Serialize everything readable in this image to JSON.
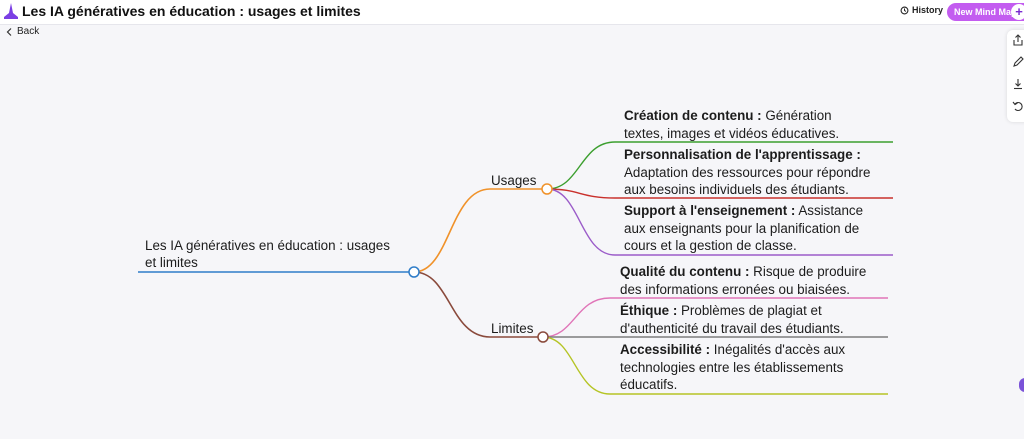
{
  "header": {
    "title": "Les IA génératives en éducation : usages et limites",
    "history_label": "History",
    "new_map_label": "New Mind Map",
    "plus": "+"
  },
  "nav": {
    "back_label": "Back"
  },
  "toolbar": {
    "icons": [
      "share-icon",
      "pen-icon",
      "download-icon",
      "undo-icon"
    ]
  },
  "mindmap": {
    "root": {
      "line1": "Les IA génératives en éducation : usages",
      "line2": "et limites",
      "color": "#2f7dc9"
    },
    "branches": [
      {
        "label": "Usages",
        "color": "#f0922a",
        "children": [
          {
            "bold": "Création de contenu :",
            "rest": " Génération",
            "lines": [
              "textes, images et vidéos éducatives."
            ],
            "color": "#3c9f2f"
          },
          {
            "bold": "Personnalisation de l'apprentissage :",
            "rest": "",
            "lines": [
              "Adaptation des ressources pour répondre",
              "aux besoins individuels des étudiants."
            ],
            "color": "#c9302c"
          },
          {
            "bold": "Support à l'enseignement :",
            "rest": " Assistance",
            "lines": [
              "aux enseignants pour la planification de",
              "cours et la gestion de classe."
            ],
            "color": "#9b5cc9"
          }
        ]
      },
      {
        "label": "Limites",
        "color": "#8a4a3c",
        "children": [
          {
            "bold": "Qualité du contenu :",
            "rest": " Risque de produire",
            "lines": [
              "des informations erronées ou biaisées."
            ],
            "color": "#e075b8"
          },
          {
            "bold": "Éthique :",
            "rest": " Problèmes de plagiat et",
            "lines": [
              "d'authenticité du travail des étudiants."
            ],
            "color": "#7d7d7d"
          },
          {
            "bold": "Accessibilité :",
            "rest": " Inégalités d'accès aux",
            "lines": [
              "technologies entre les établissements",
              "éducatifs."
            ],
            "color": "#b5c425"
          }
        ]
      }
    ]
  }
}
